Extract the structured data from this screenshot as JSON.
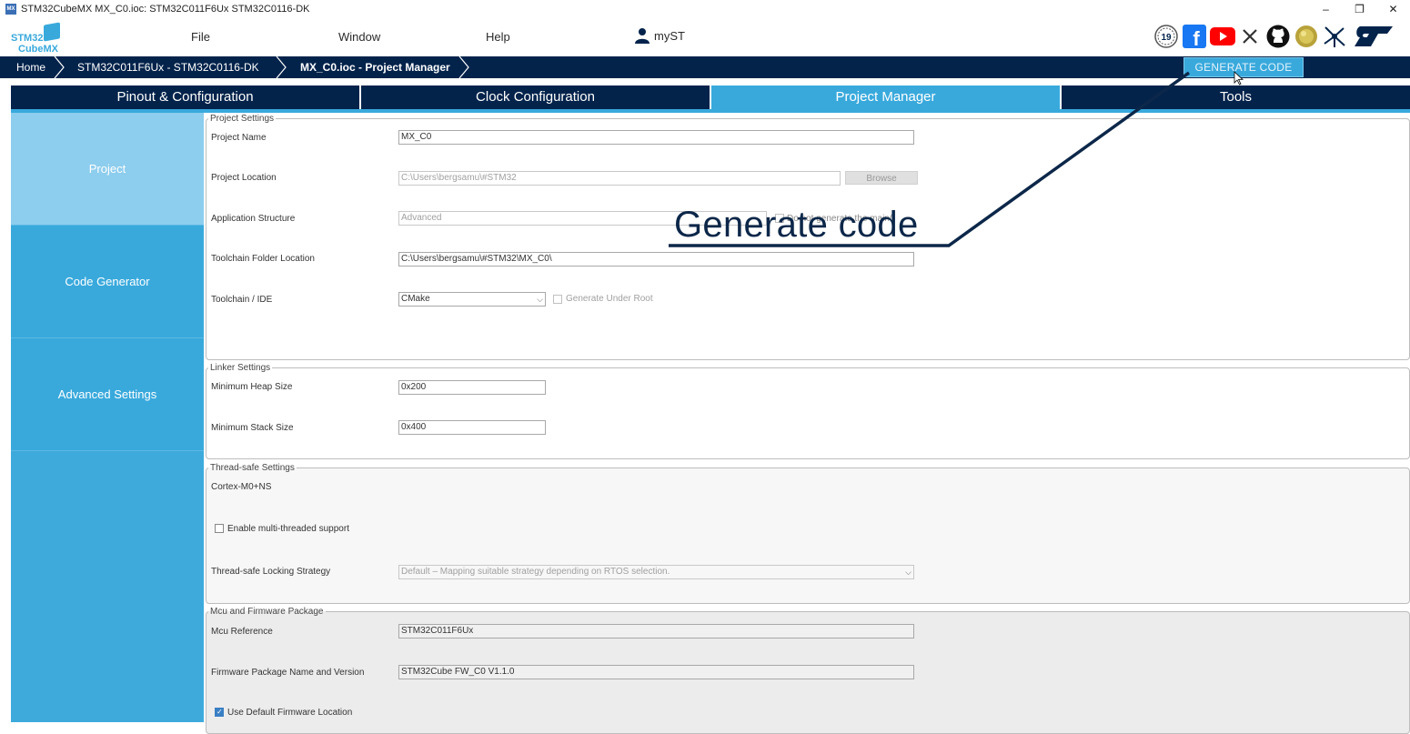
{
  "window": {
    "title": "STM32CubeMX MX_C0.ioc: STM32C011F6Ux STM32C0116-DK",
    "app_icon": "MX",
    "controls": {
      "minimize": "–",
      "restore": "❐",
      "close": "✕"
    }
  },
  "logo": {
    "line1": "STM32",
    "line2": "CubeMX"
  },
  "menu": {
    "file": "File",
    "window": "Window",
    "help": "Help",
    "myst": "myST"
  },
  "social_icons": [
    "anniversary-19-icon",
    "facebook-icon",
    "youtube-icon",
    "x-icon",
    "github-icon",
    "community-icon",
    "network-icon",
    "st-logo-icon"
  ],
  "breadcrumb": {
    "home": "Home",
    "device": "STM32C011F6Ux  -  STM32C0116-DK",
    "current": "MX_C0.ioc - Project Manager"
  },
  "generate_button": "GENERATE CODE",
  "tabs": [
    {
      "label": "Pinout & Configuration",
      "active": false
    },
    {
      "label": "Clock Configuration",
      "active": false
    },
    {
      "label": "Project Manager",
      "active": true
    },
    {
      "label": "Tools",
      "active": false
    }
  ],
  "sidebar": {
    "items": [
      {
        "label": "Project",
        "active": true
      },
      {
        "label": "Code Generator",
        "active": false
      },
      {
        "label": "Advanced Settings",
        "active": false
      }
    ]
  },
  "project_settings": {
    "legend": "Project Settings",
    "project_name_label": "Project Name",
    "project_name": "MX_C0",
    "project_location_label": "Project Location",
    "project_location": "C:\\Users\\bergsamu\\#STM32",
    "browse": "Browse",
    "app_structure_label": "Application Structure",
    "app_structure": "Advanced",
    "no_main_label": "Do not generate the main()",
    "toolchain_folder_label": "Toolchain Folder Location",
    "toolchain_folder": "C:\\Users\\bergsamu\\#STM32\\MX_C0\\",
    "toolchain_ide_label": "Toolchain / IDE",
    "toolchain_ide": "CMake",
    "generate_under_root": "Generate Under Root"
  },
  "linker_settings": {
    "legend": "Linker Settings",
    "heap_label": "Minimum Heap Size",
    "heap": "0x200",
    "stack_label": "Minimum Stack Size",
    "stack": "0x400"
  },
  "thread_safe": {
    "legend": "Thread-safe Settings",
    "core": "Cortex-M0+NS",
    "multi_threaded": "Enable multi-threaded support",
    "strategy_label": "Thread-safe Locking Strategy",
    "strategy": "Default – Mapping suitable strategy depending on RTOS selection."
  },
  "mcu_firmware": {
    "legend": "Mcu and Firmware Package",
    "mcu_ref_label": "Mcu Reference",
    "mcu_ref": "STM32C011F6Ux",
    "fw_label": "Firmware Package Name and Version",
    "fw": "STM32Cube FW_C0 V1.1.0",
    "default_location": "Use Default Firmware Location"
  },
  "annotation": {
    "text": "Generate code"
  },
  "colors": {
    "navy": "#03234b",
    "accent": "#39a9dc",
    "active_side": "#8dcdee"
  }
}
